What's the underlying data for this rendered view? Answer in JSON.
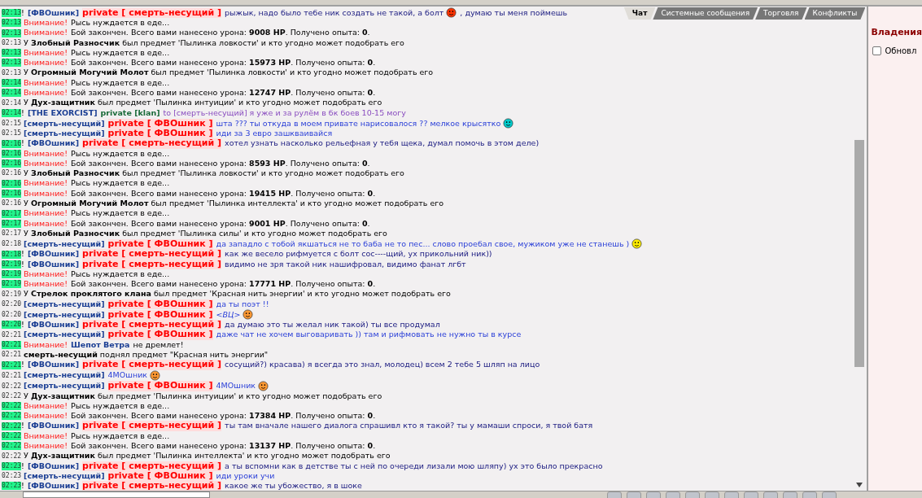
{
  "tabs": [
    {
      "label": "Чат",
      "selected": true
    },
    {
      "label": "Системные сообщения",
      "selected": false
    },
    {
      "label": "Торговля",
      "selected": false
    },
    {
      "label": "Конфликты",
      "selected": false
    }
  ],
  "messages": [
    {
      "time": "02:13",
      "time_highlight": true,
      "parts": [
        {
          "kind": "bang",
          "text": "!"
        },
        {
          "kind": "nick",
          "text": "[ФВОшник]"
        },
        {
          "kind": "private",
          "text": "private [ смерть-несущий ]"
        },
        {
          "kind": "msg_in",
          "text": "рыжык, надо было тебе ник создать не такой, а болт"
        },
        {
          "kind": "smiley",
          "color": "#ff3300"
        },
        {
          "kind": "msg_in",
          "text": ", думаю ты меня поймешь"
        }
      ]
    },
    {
      "time": "02:13",
      "time_highlight": true,
      "parts": [
        {
          "kind": "alert",
          "text": "Внимание!"
        },
        {
          "kind": "system",
          "text": "Рысь нуждается в еде..."
        }
      ]
    },
    {
      "time": "02:13",
      "time_highlight": true,
      "parts": [
        {
          "kind": "alert",
          "text": "Внимание!"
        },
        {
          "kind": "system",
          "text": "Бой закончен. Всего вами нанесено урона: **9008 HP**. Получено опыта: **0**."
        }
      ]
    },
    {
      "time": "02:13",
      "time_highlight": false,
      "parts": [
        {
          "kind": "system",
          "text": "У **Злобный Разносчик** был предмет 'Пылинка ловкости' и кто угодно может подобрать его"
        }
      ]
    },
    {
      "time": "02:13",
      "time_highlight": true,
      "parts": [
        {
          "kind": "alert",
          "text": "Внимание!"
        },
        {
          "kind": "system",
          "text": "Рысь нуждается в еде..."
        }
      ]
    },
    {
      "time": "02:13",
      "time_highlight": true,
      "parts": [
        {
          "kind": "alert",
          "text": "Внимание!"
        },
        {
          "kind": "system",
          "text": "Бой закончен. Всего вами нанесено урона: **15973 HP**. Получено опыта: **0**."
        }
      ]
    },
    {
      "time": "02:13",
      "time_highlight": false,
      "parts": [
        {
          "kind": "system",
          "text": "У **Огромный Могучий Молот** был предмет 'Пылинка ловкости' и кто угодно может подобрать его"
        }
      ]
    },
    {
      "time": "02:14",
      "time_highlight": true,
      "parts": [
        {
          "kind": "alert",
          "text": "Внимание!"
        },
        {
          "kind": "system",
          "text": "Рысь нуждается в еде..."
        }
      ]
    },
    {
      "time": "02:14",
      "time_highlight": true,
      "parts": [
        {
          "kind": "alert",
          "text": "Внимание!"
        },
        {
          "kind": "system",
          "text": "Бой закончен. Всего вами нанесено урона: **12747 HP**. Получено опыта: **0**."
        }
      ]
    },
    {
      "time": "02:14",
      "time_highlight": false,
      "parts": [
        {
          "kind": "system",
          "text": "У **Дух-защитник** был предмет 'Пылинка интуиции' и кто угодно может подобрать его"
        }
      ]
    },
    {
      "time": "02:14",
      "time_highlight": true,
      "parts": [
        {
          "kind": "bang",
          "text": "!"
        },
        {
          "kind": "nick",
          "text": "[THE EXORCIST]"
        },
        {
          "kind": "clan",
          "text": "private [klan]"
        },
        {
          "kind": "msg_clan",
          "text": "to [смерть-несущий] я уже и за рулём в бк боев 10-15 могу"
        }
      ]
    },
    {
      "time": "02:15",
      "time_highlight": false,
      "parts": [
        {
          "kind": "nick",
          "text": "[смерть-несущий]"
        },
        {
          "kind": "private",
          "text": "private [ ФВОшник ]"
        },
        {
          "kind": "msg_out",
          "text": "шта ??? ты откуда в моем привате нарисовалося ?? мелкое крысятко"
        },
        {
          "kind": "smiley",
          "color": "#00cccc"
        }
      ]
    },
    {
      "time": "02:15",
      "time_highlight": false,
      "parts": [
        {
          "kind": "nick",
          "text": "[смерть-несущий]"
        },
        {
          "kind": "private",
          "text": "private [ ФВОшник ]"
        },
        {
          "kind": "msg_out",
          "text": "иди за 3 евро зашкваивайся"
        }
      ]
    },
    {
      "time": "02:16",
      "time_highlight": true,
      "parts": [
        {
          "kind": "bang",
          "text": "!"
        },
        {
          "kind": "nick",
          "text": "[ФВОшник]"
        },
        {
          "kind": "private",
          "text": "private [ смерть-несущий ]"
        },
        {
          "kind": "msg_in",
          "text": "хотел узнать насколько рельефная у тебя щека, думал помочь в этом деле)"
        }
      ]
    },
    {
      "time": "02:16",
      "time_highlight": true,
      "parts": [
        {
          "kind": "alert",
          "text": "Внимание!"
        },
        {
          "kind": "system",
          "text": "Рысь нуждается в еде..."
        }
      ]
    },
    {
      "time": "02:16",
      "time_highlight": true,
      "parts": [
        {
          "kind": "alert",
          "text": "Внимание!"
        },
        {
          "kind": "system",
          "text": "Бой закончен. Всего вами нанесено урона: **8593 HP**. Получено опыта: **0**."
        }
      ]
    },
    {
      "time": "02:16",
      "time_highlight": false,
      "parts": [
        {
          "kind": "system",
          "text": "У **Злобный Разносчик** был предмет 'Пылинка ловкости' и кто угодно может подобрать его"
        }
      ]
    },
    {
      "time": "02:16",
      "time_highlight": true,
      "parts": [
        {
          "kind": "alert",
          "text": "Внимание!"
        },
        {
          "kind": "system",
          "text": "Рысь нуждается в еде..."
        }
      ]
    },
    {
      "time": "02:16",
      "time_highlight": true,
      "parts": [
        {
          "kind": "alert",
          "text": "Внимание!"
        },
        {
          "kind": "system",
          "text": "Бой закончен. Всего вами нанесено урона: **19415 HP**. Получено опыта: **0**."
        }
      ]
    },
    {
      "time": "02:16",
      "time_highlight": false,
      "parts": [
        {
          "kind": "system",
          "text": "У **Огромный Могучий Молот** был предмет 'Пылинка интеллекта' и кто угодно может подобрать его"
        }
      ]
    },
    {
      "time": "02:17",
      "time_highlight": true,
      "parts": [
        {
          "kind": "alert",
          "text": "Внимание!"
        },
        {
          "kind": "system",
          "text": "Рысь нуждается в еде..."
        }
      ]
    },
    {
      "time": "02:17",
      "time_highlight": true,
      "parts": [
        {
          "kind": "alert",
          "text": "Внимание!"
        },
        {
          "kind": "system",
          "text": "Бой закончен. Всего вами нанесено урона: **9001 HP**. Получено опыта: **0**."
        }
      ]
    },
    {
      "time": "02:17",
      "time_highlight": false,
      "parts": [
        {
          "kind": "system",
          "text": "У **Злобный Разносчик** был предмет 'Пылинка силы' и кто угодно может подобрать его"
        }
      ]
    },
    {
      "time": "02:18",
      "time_highlight": false,
      "parts": [
        {
          "kind": "nick",
          "text": "[смерть-несущий]"
        },
        {
          "kind": "private",
          "text": "private [ ФВОшник ]"
        },
        {
          "kind": "msg_out",
          "text": "да западло с тобой якшаться не то баба не то пес... слово проебал свое, мужиком уже не станешь )"
        },
        {
          "kind": "smiley",
          "color": "#ffee00"
        }
      ]
    },
    {
      "time": "02:18",
      "time_highlight": true,
      "parts": [
        {
          "kind": "bang",
          "text": "!"
        },
        {
          "kind": "nick",
          "text": "[ФВОшник]"
        },
        {
          "kind": "private",
          "text": "private [ смерть-несущий ]"
        },
        {
          "kind": "msg_in",
          "text": "как же весело рифмуется с болт сос----щий, ух прикольний ник))"
        }
      ]
    },
    {
      "time": "02:19",
      "time_highlight": true,
      "parts": [
        {
          "kind": "bang",
          "text": "!"
        },
        {
          "kind": "nick",
          "text": "[ФВОшник]"
        },
        {
          "kind": "private",
          "text": "private [ смерть-несущий ]"
        },
        {
          "kind": "msg_in",
          "text": "видимо не зря такой ник нашифровал, видимо фанат лгбт"
        }
      ]
    },
    {
      "time": "02:19",
      "time_highlight": true,
      "parts": [
        {
          "kind": "alert",
          "text": "Внимание!"
        },
        {
          "kind": "system",
          "text": "Рысь нуждается в еде..."
        }
      ]
    },
    {
      "time": "02:19",
      "time_highlight": true,
      "parts": [
        {
          "kind": "alert",
          "text": "Внимание!"
        },
        {
          "kind": "system",
          "text": "Бой закончен. Всего вами нанесено урона: **17771 HP**. Получено опыта: **0**."
        }
      ]
    },
    {
      "time": "02:19",
      "time_highlight": false,
      "parts": [
        {
          "kind": "system",
          "text": "У **Стрелок проклятого клана** был предмет 'Красная нить энергии' и кто угодно может подобрать его"
        }
      ]
    },
    {
      "time": "02:20",
      "time_highlight": false,
      "parts": [
        {
          "kind": "nick",
          "text": "[смерть-несущий]"
        },
        {
          "kind": "private",
          "text": "private [ ФВОшник ]"
        },
        {
          "kind": "msg_out",
          "text": "да ты поэт !!"
        }
      ]
    },
    {
      "time": "02:20",
      "time_highlight": false,
      "parts": [
        {
          "kind": "nick",
          "text": "[смерть-несущий]"
        },
        {
          "kind": "private",
          "text": "private [ ФВОшник ]"
        },
        {
          "kind": "msg_out",
          "text": "*<ВЦ>*"
        },
        {
          "kind": "smiley",
          "color": "#ff9933"
        }
      ]
    },
    {
      "time": "02:20",
      "time_highlight": true,
      "parts": [
        {
          "kind": "bang",
          "text": "!"
        },
        {
          "kind": "nick",
          "text": "[ФВОшник]"
        },
        {
          "kind": "private",
          "text": "private [ смерть-несущий ]"
        },
        {
          "kind": "msg_in",
          "text": "да думаю это ты желал ник такой) ты все продумал"
        }
      ]
    },
    {
      "time": "02:21",
      "time_highlight": false,
      "parts": [
        {
          "kind": "nick",
          "text": "[смерть-несущий]"
        },
        {
          "kind": "private",
          "text": "private [ ФВОшник ]"
        },
        {
          "kind": "msg_out",
          "text": "даже чат не хочем выговаривать )) там и рифмовать не нужно ты в курсе"
        }
      ]
    },
    {
      "time": "02:21",
      "time_highlight": true,
      "parts": [
        {
          "kind": "alert",
          "text": "Внимание!"
        },
        {
          "kind": "name",
          "text": "Шепот Ветра"
        },
        {
          "kind": "system",
          "text": "не дремлет!"
        }
      ]
    },
    {
      "time": "02:21",
      "time_highlight": false,
      "parts": [
        {
          "kind": "system",
          "text": "**смерть-несущий** поднял предмет \"Красная нить энергии\""
        }
      ]
    },
    {
      "time": "02:21",
      "time_highlight": true,
      "parts": [
        {
          "kind": "bang",
          "text": "!"
        },
        {
          "kind": "nick",
          "text": "[ФВОшник]"
        },
        {
          "kind": "private",
          "text": "private [ смерть-несущий ]"
        },
        {
          "kind": "msg_in",
          "text": "сосущий?) красава) я всегда это знал, молодец) всем 2 тебе 5 шляп на лицо"
        }
      ]
    },
    {
      "time": "02:21",
      "time_highlight": false,
      "parts": [
        {
          "kind": "nick",
          "text": "[смерть-несущий]"
        },
        {
          "kind": "msg_out",
          "text": "4МОшник"
        },
        {
          "kind": "smiley",
          "color": "#ff9933"
        }
      ]
    },
    {
      "time": "02:22",
      "time_highlight": false,
      "parts": [
        {
          "kind": "nick",
          "text": "[смерть-несущий]"
        },
        {
          "kind": "private",
          "text": "private [ ФВОшник ]"
        },
        {
          "kind": "msg_out",
          "text": "4МОшник"
        },
        {
          "kind": "smiley",
          "color": "#ff9933"
        }
      ]
    },
    {
      "time": "02:22",
      "time_highlight": false,
      "parts": [
        {
          "kind": "system",
          "text": "У **Дух-защитник** был предмет 'Пылинка интуиции' и кто угодно может подобрать его"
        }
      ]
    },
    {
      "time": "02:22",
      "time_highlight": true,
      "parts": [
        {
          "kind": "alert",
          "text": "Внимание!"
        },
        {
          "kind": "system",
          "text": "Рысь нуждается в еде..."
        }
      ]
    },
    {
      "time": "02:22",
      "time_highlight": true,
      "parts": [
        {
          "kind": "alert",
          "text": "Внимание!"
        },
        {
          "kind": "system",
          "text": "Бой закончен. Всего вами нанесено урона: **17384 HP**. Получено опыта: **0**."
        }
      ]
    },
    {
      "time": "02:22",
      "time_highlight": true,
      "parts": [
        {
          "kind": "bang",
          "text": "!"
        },
        {
          "kind": "nick",
          "text": "[ФВОшник]"
        },
        {
          "kind": "private",
          "text": "private [ смерть-несущий ]"
        },
        {
          "kind": "msg_in",
          "text": "ты там вначале нашего диалога спрашивл кто я такой? ты у мамаши спроси, я твой батя"
        }
      ]
    },
    {
      "time": "02:22",
      "time_highlight": true,
      "parts": [
        {
          "kind": "alert",
          "text": "Внимание!"
        },
        {
          "kind": "system",
          "text": "Рысь нуждается в еде..."
        }
      ]
    },
    {
      "time": "02:22",
      "time_highlight": true,
      "parts": [
        {
          "kind": "alert",
          "text": "Внимание!"
        },
        {
          "kind": "system",
          "text": "Бой закончен. Всего вами нанесено урона: **13137 HP**. Получено опыта: **0**."
        }
      ]
    },
    {
      "time": "02:22",
      "time_highlight": false,
      "parts": [
        {
          "kind": "system",
          "text": "У **Дух-защитник** был предмет 'Пылинка интеллекта' и кто угодно может подобрать его"
        }
      ]
    },
    {
      "time": "02:23",
      "time_highlight": true,
      "parts": [
        {
          "kind": "bang",
          "text": "!"
        },
        {
          "kind": "nick",
          "text": "[ФВОшник]"
        },
        {
          "kind": "private",
          "text": "private [ смерть-несущий ]"
        },
        {
          "kind": "msg_in",
          "text": "а ты вспомни как в детстве ты с ней по очереди лизали мою шляпу) ух это было прекрасно"
        }
      ]
    },
    {
      "time": "02:23",
      "time_highlight": false,
      "parts": [
        {
          "kind": "nick",
          "text": "[смерть-несущий]"
        },
        {
          "kind": "private",
          "text": "private [ ФВОшник ]"
        },
        {
          "kind": "msg_out",
          "text": "иди уроки учи"
        }
      ]
    },
    {
      "time": "02:23",
      "time_highlight": true,
      "parts": [
        {
          "kind": "bang",
          "text": "!"
        },
        {
          "kind": "nick",
          "text": "[ФВОшник]"
        },
        {
          "kind": "private",
          "text": "private [ смерть-несущий ]"
        },
        {
          "kind": "msg_in",
          "text": "какое же ты убожество, я в шоке"
        }
      ]
    }
  ],
  "side_panel": {
    "heading": "Владения",
    "checkbox": {
      "label": "Обновл",
      "checked": false
    }
  }
}
